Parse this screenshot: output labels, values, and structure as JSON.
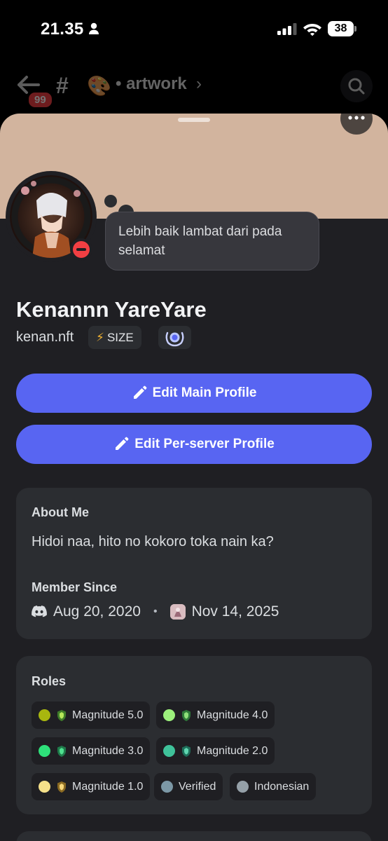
{
  "status_bar": {
    "time": "21.35",
    "battery": "38"
  },
  "channel_header": {
    "unread_badge": "99",
    "channel_emoji": "🎨",
    "channel_name": "• artwork",
    "chevron": "›"
  },
  "profile": {
    "custom_status": "Lebih baik lambat dari pada selamat",
    "display_name": "Kenannn YareYare",
    "username": "kenan.nft",
    "server_tag": {
      "icon": "⚡",
      "label": "SIZE"
    },
    "online_status": "do-not-disturb",
    "banner_color": "#d2b49e"
  },
  "actions": {
    "edit_main": "Edit Main Profile",
    "edit_server": "Edit Per-server Profile",
    "accent_color": "#5865f2"
  },
  "about": {
    "title": "About Me",
    "text": "Hidoi naa, hito no kokoro toka nain ka?"
  },
  "member_since": {
    "title": "Member Since",
    "discord_date": "Aug 20, 2020",
    "separator": "•",
    "server_date": "Nov 14, 2025"
  },
  "roles": {
    "title": "Roles",
    "items": [
      {
        "label": "Magnitude 5.0",
        "color": "#a8b60f",
        "icon": "shield-icon"
      },
      {
        "label": "Magnitude 4.0",
        "color": "#9cf07c",
        "icon": "shield-icon"
      },
      {
        "label": "Magnitude 3.0",
        "color": "#2ee07a",
        "icon": "shield-icon"
      },
      {
        "label": "Magnitude 2.0",
        "color": "#3fc29a",
        "icon": "shield-icon"
      },
      {
        "label": "Magnitude 1.0",
        "color": "#f5e08a",
        "icon": "shield-icon"
      },
      {
        "label": "Verified",
        "color": "#7c98a6"
      },
      {
        "label": "Indonesian",
        "color": "#95a0a8"
      }
    ]
  }
}
